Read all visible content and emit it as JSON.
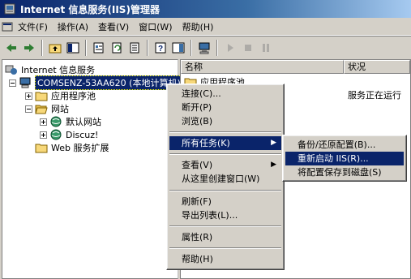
{
  "window": {
    "title": "Internet 信息服务(IIS)管理器"
  },
  "menubar": [
    {
      "label": "文件(F)"
    },
    {
      "label": "操作(A)"
    },
    {
      "label": "查看(V)"
    },
    {
      "label": "窗口(W)"
    },
    {
      "label": "帮助(H)"
    }
  ],
  "tree": {
    "root": "Internet 信息服务",
    "server": "COMSENZ-53AA620 (本地计算机)",
    "app_pools": "应用程序池",
    "websites": "网站",
    "default_site": "默认网站",
    "discuz": "Discuz!",
    "web_ext": "Web 服务扩展"
  },
  "list": {
    "columns": [
      "名称",
      "状况"
    ],
    "rows": [
      {
        "name": "应用程序池",
        "status": "服务正在运行"
      }
    ]
  },
  "context_menu": {
    "connect": "连接(C)...",
    "disconnect": "断开(P)",
    "browse": "浏览(B)",
    "all_tasks": "所有任务(K)",
    "view": "查看(V)",
    "new_window": "从这里创建窗口(W)",
    "refresh": "刷新(F)",
    "export": "导出列表(L)...",
    "properties": "属性(R)",
    "help": "帮助(H)"
  },
  "submenu": {
    "backup": "备份/还原配置(B)...",
    "restart": "重新启动 IIS(R)...",
    "save": "将配置保存到磁盘(S)"
  },
  "colors": {
    "selection": "#0a246a",
    "face": "#d4d0c8"
  }
}
